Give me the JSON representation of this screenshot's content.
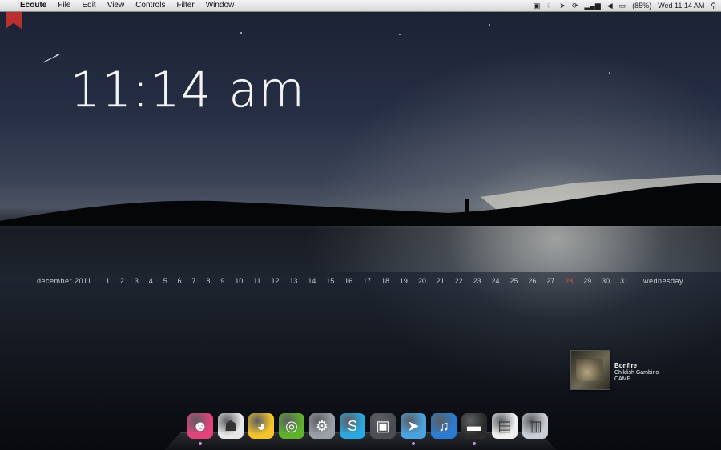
{
  "menubar": {
    "app_name": "Ecoute",
    "items": [
      "File",
      "Edit",
      "View",
      "Controls",
      "Filter",
      "Window"
    ],
    "battery": "(85%)",
    "datetime": "Wed 11:14 AM"
  },
  "clock": {
    "time": "11:14 am"
  },
  "calendar": {
    "month_label": "december 2011",
    "days": [
      "1",
      "2",
      "3",
      "4",
      "5",
      "6",
      "7",
      "8",
      "9",
      "10",
      "11",
      "12",
      "13",
      "14",
      "15",
      "16",
      "17",
      "18",
      "19",
      "20",
      "21",
      "22",
      "23",
      "24",
      "25",
      "26",
      "27",
      "28",
      "29",
      "30",
      "31"
    ],
    "today": "28",
    "weekday": "wednesday"
  },
  "now_playing": {
    "title": "Bonfire",
    "artist": "Childish Gambino",
    "album": "CAMP"
  },
  "dock": {
    "items": [
      {
        "name": "screaming-app-icon",
        "glyph": "☻",
        "color": "#e2437a"
      },
      {
        "name": "stormtrooper-icon",
        "glyph": "☗",
        "color": "#e8e8e8"
      },
      {
        "name": "cyberduck-icon",
        "glyph": "◕",
        "color": "#f3c52b"
      },
      {
        "name": "podcast-icon",
        "glyph": "◎",
        "color": "#5fb22d"
      },
      {
        "name": "steam-icon",
        "glyph": "⚙",
        "color": "#9aa0a8"
      },
      {
        "name": "skype-icon",
        "glyph": "S",
        "color": "#2aa8e0"
      },
      {
        "name": "activity-monitor-icon",
        "glyph": "▣",
        "color": "#4a4d52"
      },
      {
        "name": "paper-plane-icon",
        "glyph": "➤",
        "color": "#4aa3e0"
      },
      {
        "name": "itunes-icon",
        "glyph": "♫",
        "color": "#2b7bd0"
      },
      {
        "name": "terminal-drive-icon",
        "glyph": "▬",
        "color": "#2b2b2b"
      },
      {
        "name": "document-icon",
        "glyph": "▤",
        "color": "#f0f0f0"
      },
      {
        "name": "trash-icon",
        "glyph": "▥",
        "color": "#c9ced5"
      }
    ]
  }
}
